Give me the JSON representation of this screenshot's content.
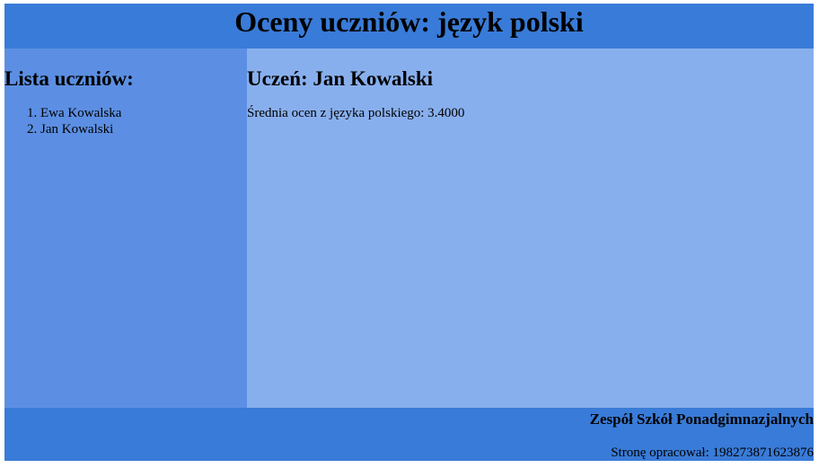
{
  "header": {
    "title": "Oceny uczniów: język polski"
  },
  "sidebar": {
    "heading": "Lista uczniów:",
    "students": [
      "Ewa Kowalska",
      "Jan Kowalski"
    ]
  },
  "main": {
    "heading": "Uczeń: Jan Kowalski",
    "average_text": "Średnia ocen z języka polskiego: 3.4000"
  },
  "footer": {
    "school": "Zespół Szkół Ponadgimnazjalnych",
    "author": "Stronę opracował: 198273871623876"
  },
  "colors": {
    "banner": "#397bd8",
    "left_panel": "#5c8fe3",
    "right_panel": "#88afed"
  }
}
